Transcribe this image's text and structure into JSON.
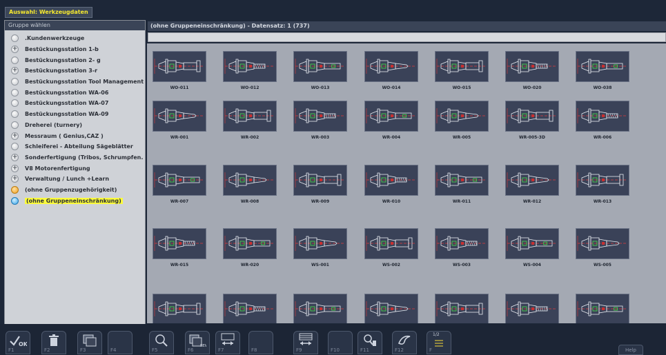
{
  "window": {
    "title": "Auswahl: Werkzeugdaten"
  },
  "group_panel": {
    "header": "Gruppe wählen",
    "groups": [
      {
        "label": ".Kundenwerkzeuge",
        "icon": "empty-circle-icon"
      },
      {
        "label": "Bestückungsstation 1-b",
        "icon": "plus-circle-icon"
      },
      {
        "label": "Bestückungsstation 2- g",
        "icon": "empty-circle-icon"
      },
      {
        "label": "Bestückungsstation 3-r",
        "icon": "plus-circle-icon"
      },
      {
        "label": "Bestückungsstation Tool Management",
        "icon": "empty-circle-icon"
      },
      {
        "label": "Bestückungsstation WA-06",
        "icon": "empty-circle-icon"
      },
      {
        "label": "Bestückungsstation WA-07",
        "icon": "empty-circle-icon"
      },
      {
        "label": "Bestückungsstation WA-09",
        "icon": "empty-circle-icon"
      },
      {
        "label": "Dreherei (turnery)",
        "icon": "empty-circle-icon"
      },
      {
        "label": "Messraum ( Genius,CAZ )",
        "icon": "plus-circle-icon"
      },
      {
        "label": "Schleiferei - Abteilung Sägeblätter",
        "icon": "empty-circle-icon"
      },
      {
        "label": "Sonderfertigung (Tribos, Schrumpfen..",
        "icon": "plus-circle-icon"
      },
      {
        "label": "V8 Motorenfertigung",
        "icon": "plus-circle-icon"
      },
      {
        "label": "Verwaltung / Lunch +Learn",
        "icon": "plus-circle-icon"
      },
      {
        "label": "(ohne Gruppenzugehörigkeit)",
        "icon": "orange-circle-icon"
      },
      {
        "label": "(ohne Gruppeneinschränkung)",
        "icon": "blue-circle-icon",
        "selected": true
      }
    ]
  },
  "main": {
    "header": "(ohne Gruppeneinschränkung) - Datensatz: 1 (737)",
    "search_value": "",
    "tools": [
      [
        "WO-011",
        "WO-012",
        "WO-013",
        "WO-014",
        "WO-015",
        "WO-020",
        "WO-038"
      ],
      [
        "WR-001",
        "WR-002",
        "WR-003",
        "WR-004",
        "WR-005",
        "WR-005-3D",
        "WR-006"
      ],
      [
        "WR-007",
        "WR-008",
        "WR-009",
        "WR-010",
        "WR-011",
        "WR-012",
        "WR-013"
      ],
      [
        "WR-015",
        "WR-020",
        "WS-001",
        "WS-002",
        "WS-003",
        "WS-004",
        "WS-005"
      ],
      [
        "",
        "",
        "",
        "",
        "",
        "",
        ""
      ]
    ]
  },
  "function_keys": [
    {
      "label": "F1",
      "icon": "ok-check-icon"
    },
    {
      "label": "F2",
      "icon": "trash-icon"
    },
    {
      "label": "F3",
      "icon": "copy-cards-icon"
    },
    {
      "label": "F4",
      "icon": ""
    },
    {
      "label": "F5",
      "icon": "magnify-tool-icon"
    },
    {
      "label": "F6",
      "icon": "new-cards-icon"
    },
    {
      "label": "F7",
      "icon": "compare-arrows-icon"
    },
    {
      "label": "F8",
      "icon": ""
    },
    {
      "label": "F9",
      "icon": "table-arrows-icon"
    },
    {
      "label": "F10",
      "icon": ""
    },
    {
      "label": "F11",
      "icon": "search-delete-icon"
    },
    {
      "label": "F12",
      "icon": "bird-logo-icon"
    },
    {
      "label": "F",
      "icon": "page-toggle-icon",
      "badge": "1/2"
    }
  ],
  "help": {
    "label": "Help"
  },
  "colors": {
    "accent_yellow": "#f7ea2e",
    "selection_yellow": "#fbfb3c",
    "tool_bg": "#3a4258",
    "panel_bg": "#cfd2d7"
  }
}
